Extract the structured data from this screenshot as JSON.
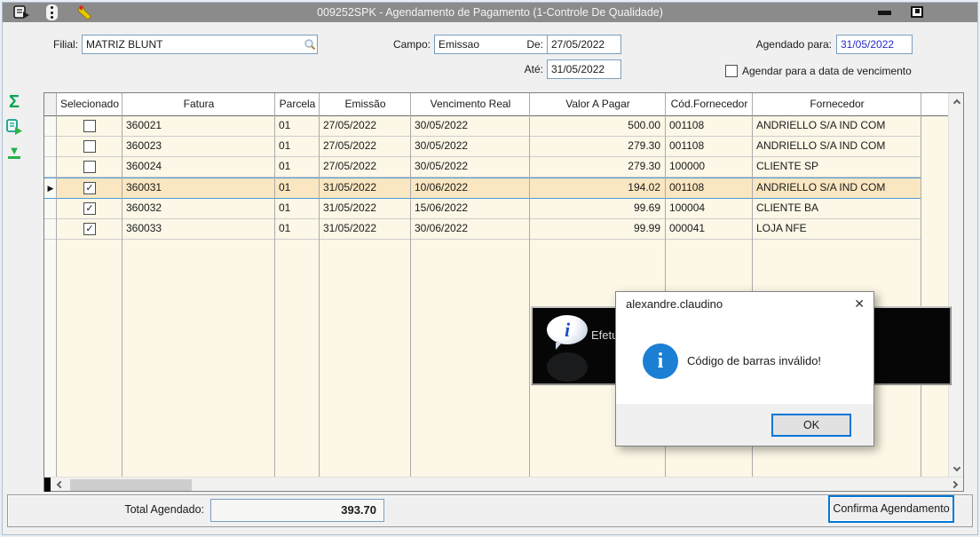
{
  "titlebar": {
    "title": "009252SPK - Agendamento de Pagamento (1-Controle De Qualidade)"
  },
  "filters": {
    "filial_label": "Filial:",
    "filial_value": "MATRIZ BLUNT",
    "campo_label": "Campo:",
    "campo_value": "Emissao",
    "de_label": "De:",
    "de_value": "27/05/2022",
    "ate_label": "Até:",
    "ate_value": "31/05/2022",
    "agendado_label": "Agendado para:",
    "agendado_value": "31/05/2022",
    "agendar_checkbox_label": "Agendar para a data de vencimento",
    "agendar_checkbox_checked": false
  },
  "icons": {
    "sum_icon": "Σ",
    "goto_end_icon": "▼",
    "check_glyph": "✓",
    "row_pointer": "▶"
  },
  "grid": {
    "columns": [
      "Selecionado",
      "Fatura",
      "Parcela",
      "Emissão",
      "Vencimento Real",
      "Valor A Pagar",
      "Cód.Fornecedor",
      "Fornecedor"
    ],
    "rows": [
      {
        "selecionado": false,
        "fatura": "360021",
        "parcela": "01",
        "emissao": "27/05/2022",
        "vencimento_real": "30/05/2022",
        "valor_a_pagar": "500.00",
        "cod_fornecedor": "001108",
        "fornecedor": "ANDRIELLO S/A IND COM"
      },
      {
        "selecionado": false,
        "fatura": "360023",
        "parcela": "01",
        "emissao": "27/05/2022",
        "vencimento_real": "30/05/2022",
        "valor_a_pagar": "279.30",
        "cod_fornecedor": "001108",
        "fornecedor": "ANDRIELLO S/A IND COM"
      },
      {
        "selecionado": false,
        "fatura": "360024",
        "parcela": "01",
        "emissao": "27/05/2022",
        "vencimento_real": "30/05/2022",
        "valor_a_pagar": "279.30",
        "cod_fornecedor": "100000",
        "fornecedor": "CLIENTE SP"
      },
      {
        "selecionado": true,
        "fatura": "360031",
        "parcela": "01",
        "emissao": "31/05/2022",
        "vencimento_real": "10/06/2022",
        "valor_a_pagar": "194.02",
        "cod_fornecedor": "001108",
        "fornecedor": "ANDRIELLO S/A IND COM"
      },
      {
        "selecionado": true,
        "fatura": "360032",
        "parcela": "01",
        "emissao": "31/05/2022",
        "vencimento_real": "15/06/2022",
        "valor_a_pagar": "99.69",
        "cod_fornecedor": "100004",
        "fornecedor": "CLIENTE BA"
      },
      {
        "selecionado": true,
        "fatura": "360033",
        "parcela": "01",
        "emissao": "31/05/2022",
        "vencimento_real": "30/06/2022",
        "valor_a_pagar": "99.99",
        "cod_fornecedor": "000041",
        "fornecedor": "LOJA NFE"
      }
    ],
    "active_row_index": 3
  },
  "back_dialog": {
    "visible_text": "Efetu"
  },
  "message_box": {
    "title": "alexandre.claudino",
    "message": "Código de barras inválido!",
    "ok_label": "OK",
    "close_glyph": "✕",
    "info_glyph": "i"
  },
  "footer": {
    "total_label": "Total Agendado:",
    "total_value": "393.70",
    "confirm_label": "Confirma Agendamento"
  },
  "colors": {
    "titlebar_gray": "#8B8B8B",
    "grid_background": "#FCF7E6",
    "active_row": "#FAE7C1",
    "active_row_border": "#4F9BD5",
    "focus_blue": "#0078D7",
    "info_icon_blue": "#1B7FD4",
    "agendado_value_text": "#2A2ACC"
  }
}
